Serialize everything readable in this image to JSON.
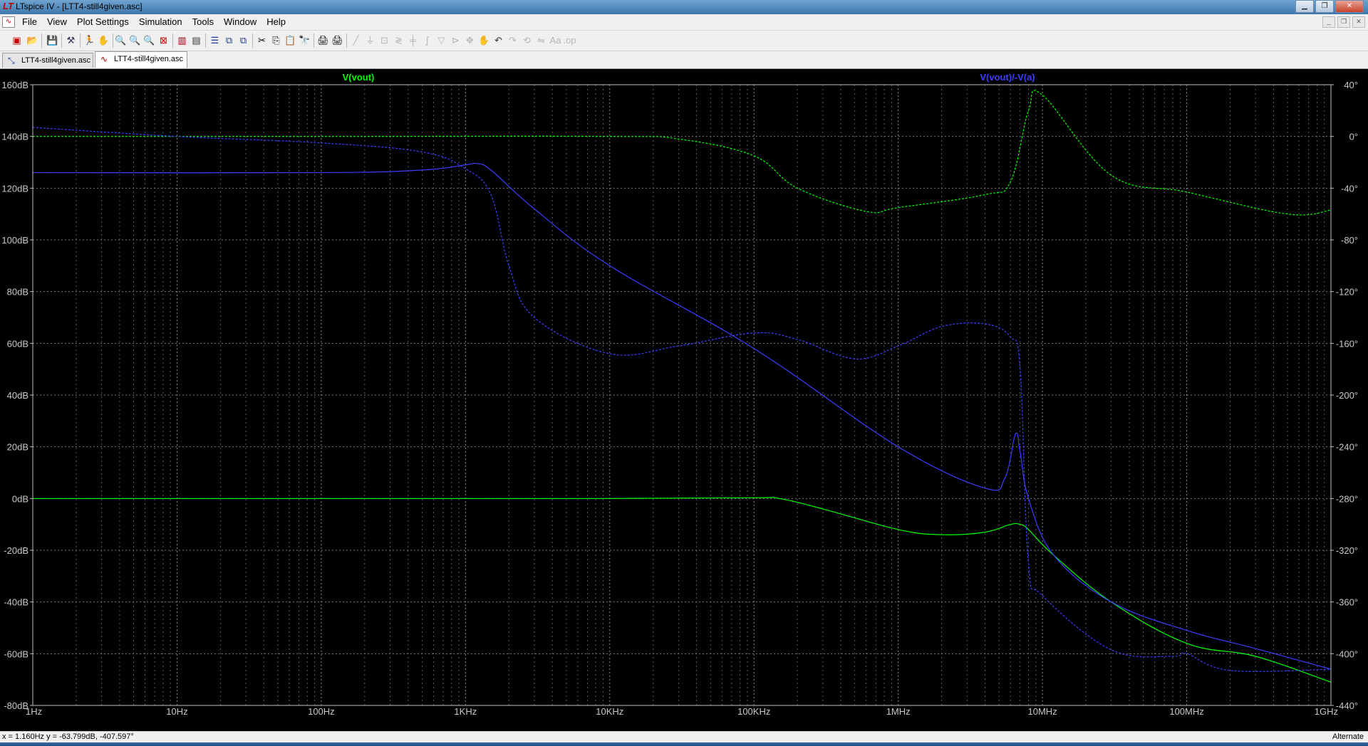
{
  "window": {
    "title": "LTspice IV - [LTT4-still4given.asc]"
  },
  "menu": [
    "File",
    "View",
    "Plot Settings",
    "Simulation",
    "Tools",
    "Window",
    "Help"
  ],
  "tabs": [
    {
      "label": "LTT4-still4given.asc",
      "icon": "schematic-icon",
      "active": false
    },
    {
      "label": "LTT4-still4given.asc",
      "icon": "waveform-icon",
      "active": true
    }
  ],
  "plot": {
    "traces": [
      {
        "label": "V(vout)",
        "color": "#00ff00"
      },
      {
        "label": "V(vout)/-V(a)",
        "color": "#3d3dff"
      }
    ],
    "left_ticks": [
      "160dB",
      "140dB",
      "120dB",
      "100dB",
      "80dB",
      "60dB",
      "40dB",
      "20dB",
      "0dB",
      "-20dB",
      "-40dB",
      "-60dB",
      "-80dB"
    ],
    "right_ticks": [
      "40°",
      "0°",
      "-40°",
      "-80°",
      "-120°",
      "-160°",
      "-200°",
      "-240°",
      "-280°",
      "-320°",
      "-360°",
      "-400°",
      "-440°"
    ],
    "x_ticks": [
      "1Hz",
      "10Hz",
      "100Hz",
      "1KHz",
      "10KHz",
      "100KHz",
      "1MHz",
      "10MHz",
      "100MHz",
      "1GHz"
    ]
  },
  "chart_data": {
    "type": "line",
    "x_scale": "log",
    "xlim": [
      1,
      1000000000
    ],
    "ylim_left": [
      -80,
      160
    ],
    "ylim_right": [
      -440,
      40
    ],
    "grid": true,
    "series": [
      {
        "name": "V(vout)",
        "quantity": "magnitude",
        "axis": "left",
        "style": "solid",
        "color": "#00ff00",
        "x": [
          1,
          100,
          10000,
          100000,
          150000,
          300000,
          1000000,
          2000000,
          4000000,
          6000000,
          7000000,
          8000000,
          12000000,
          30000000,
          100000000,
          300000000,
          1000000000
        ],
        "y": [
          0,
          0,
          0,
          0.3,
          0,
          -4,
          -12,
          -14,
          -13,
          -10,
          -10,
          -12,
          -22,
          -40,
          -56,
          -61,
          -71
        ]
      },
      {
        "name": "V(vout)",
        "quantity": "phase",
        "axis": "right",
        "style": "dashed",
        "color": "#00ff00",
        "x": [
          1,
          100,
          10000,
          30000,
          100000,
          200000,
          600000,
          1000000,
          4000000,
          6000000,
          8000000,
          10000000,
          30000000,
          100000000,
          500000000,
          1000000000
        ],
        "y": [
          0,
          0,
          0,
          -2,
          -15,
          -40,
          -58,
          -55,
          -45,
          -35,
          20,
          32,
          -30,
          -43,
          -60,
          -57
        ]
      },
      {
        "name": "V(vout)/-V(a)",
        "quantity": "magnitude",
        "axis": "left",
        "style": "solid",
        "color": "#3d3dff",
        "x": [
          1,
          100,
          500,
          1000,
          1200,
          1500,
          3000,
          10000,
          100000,
          1000000,
          4000000,
          5500000,
          6500000,
          7000000,
          8000000,
          12000000,
          30000000,
          100000000,
          300000000,
          1000000000
        ],
        "y": [
          126,
          126,
          127,
          129,
          129.5,
          127,
          112,
          90,
          58,
          20,
          4,
          8,
          25,
          18,
          0,
          -22,
          -40,
          -51,
          -58,
          -66
        ]
      },
      {
        "name": "V(vout)/-V(a)",
        "quantity": "phase",
        "axis": "right",
        "style": "dashed",
        "color": "#3d3dff",
        "x": [
          1,
          10,
          100,
          500,
          1000,
          1500,
          2000,
          3000,
          10000,
          30000,
          100000,
          200000,
          500000,
          1000000,
          2000000,
          4000000,
          6000000,
          7000000,
          8000000,
          10000000,
          30000000,
          80000000,
          100000000,
          200000000,
          1000000000
        ],
        "y": [
          7,
          0,
          -5,
          -12,
          -25,
          -45,
          -100,
          -140,
          -168,
          -162,
          -152,
          -157,
          -172,
          -162,
          -147,
          -145,
          -155,
          -180,
          -330,
          -355,
          -397,
          -402,
          -400,
          -413,
          -412
        ]
      }
    ]
  },
  "status": {
    "readout": "x = 1.160Hz    y = -63.799dB, -407.597°",
    "mode": "Alternate"
  }
}
